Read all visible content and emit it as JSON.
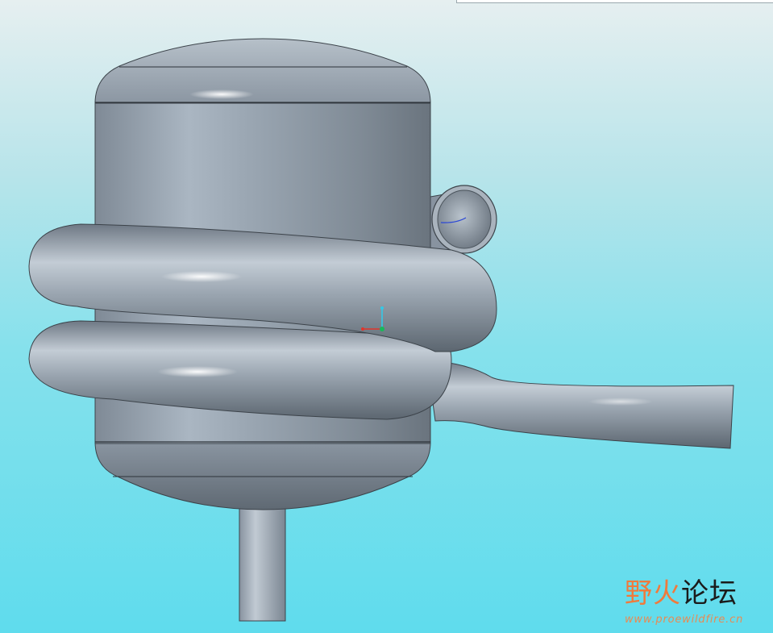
{
  "window": {
    "topbar": ""
  },
  "model": {
    "name": "",
    "colors": {
      "body": "#9aa5b0",
      "edge": "#3c434a",
      "highlight": "#ffffff",
      "background_top": "#e6eff0",
      "background_bottom": "#5fdced"
    },
    "parts": [
      "tank-body",
      "top-head",
      "bottom-head",
      "coil-upper",
      "coil-lower",
      "outlet-pipe",
      "inlet-nozzle",
      "bottom-pipe",
      "coordinate-triad"
    ]
  },
  "triad": {
    "axes": [
      "x-axis",
      "y-axis",
      "z-axis"
    ],
    "colors": {
      "x": "#e0352b",
      "y": "#34c8e6",
      "z": "#19b85a"
    }
  },
  "watermark": {
    "text_orange": "野火",
    "text_dark": "论坛",
    "url": "www.proewildfire.cn"
  }
}
